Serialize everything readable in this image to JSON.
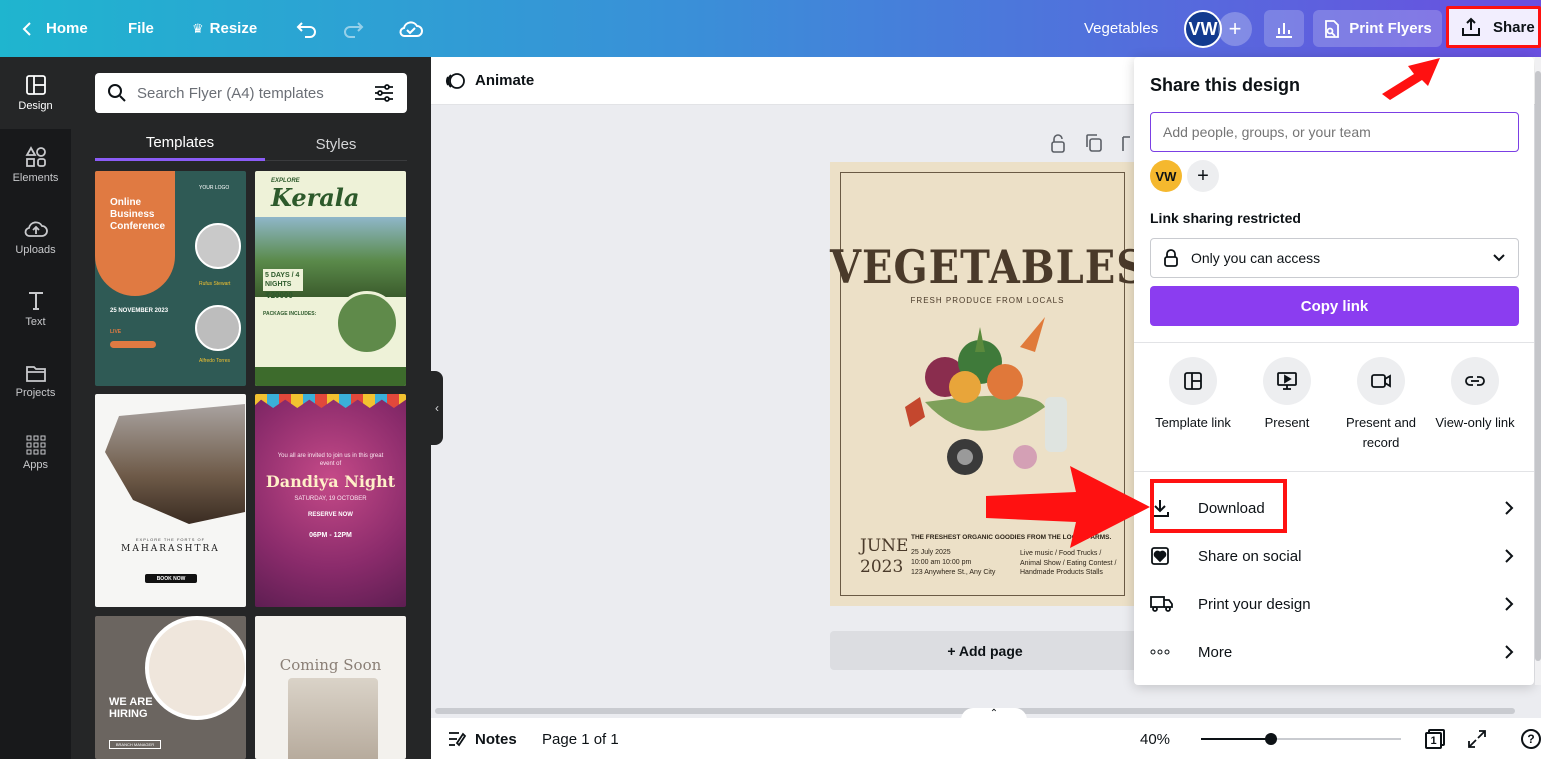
{
  "topbar": {
    "home": "Home",
    "file": "File",
    "resize": "Resize",
    "design_title": "Vegetables",
    "avatar_initials": "VW",
    "print_button": "Print Flyers",
    "share_button": "Share"
  },
  "rail": {
    "items": [
      {
        "label": "Design",
        "icon": "design-icon"
      },
      {
        "label": "Elements",
        "icon": "elements-icon"
      },
      {
        "label": "Uploads",
        "icon": "uploads-icon"
      },
      {
        "label": "Text",
        "icon": "text-icon"
      },
      {
        "label": "Projects",
        "icon": "projects-icon"
      },
      {
        "label": "Apps",
        "icon": "apps-icon"
      }
    ]
  },
  "panel": {
    "search_placeholder": "Search Flyer (A4) templates",
    "tabs": [
      "Templates",
      "Styles"
    ],
    "templates": [
      {
        "title": "Online Business Conference",
        "date": "25 NOVEMBER 2023",
        "person1": "Rufus Stewart",
        "person2": "Alfredo Torres",
        "logo": "YOUR LOGO",
        "tag": "LIVE"
      },
      {
        "title": "Kerala",
        "pre": "EXPLORE",
        "days": "5 DAYS / 4 NIGHTS",
        "price": "₹20000",
        "package": "PACKAGE INCLUDES:"
      },
      {
        "title": "MAHARASHTRA",
        "pre": "EXPLORE THE FORTS OF",
        "cta": "BOOK NOW"
      },
      {
        "title": "Dandiya Night",
        "intro": "You all are invited to join us in this great event of",
        "date": "SATURDAY, 19 OCTOBER",
        "reserve": "RESERVE NOW",
        "time": "06PM - 12PM"
      },
      {
        "title": "WE ARE HIRING",
        "cta": "BRANCH MANAGER"
      },
      {
        "title": "Coming Soon"
      }
    ]
  },
  "canvas": {
    "animate": "Animate",
    "add_page": "+ Add page",
    "flyer": {
      "title": "VEGETABLES",
      "subtitle": "FRESH PRODUCE FROM LOCALS",
      "month": "JUNE",
      "year": "2023",
      "headline": "THE FRESHEST ORGANIC GOODIES FROM THE LOCAL FARMS.",
      "date": "25 July 2025",
      "time": "10:00 am  10:00 pm",
      "address": "123 Anywhere St., Any City",
      "activities": "Live music / Food Trucks / Animal Show / Eating Contest / Handmade Products Stalls"
    }
  },
  "bottombar": {
    "notes": "Notes",
    "page": "Page 1 of 1",
    "zoom": "40%",
    "zoom_fraction": 0.35,
    "page_count_badge": "1"
  },
  "share_panel": {
    "title": "Share this design",
    "input_placeholder": "Add people, groups, or your team",
    "avatar_initials": "VW",
    "link_label": "Link sharing restricted",
    "access_value": "Only you can access",
    "copy_link": "Copy link",
    "options": [
      {
        "label": "Template link",
        "icon": "template-link-icon"
      },
      {
        "label": "Present",
        "icon": "present-icon"
      },
      {
        "label": "Present and record",
        "icon": "record-icon"
      },
      {
        "label": "View-only link",
        "icon": "link-icon"
      }
    ],
    "rows": [
      {
        "label": "Download",
        "icon": "download-icon"
      },
      {
        "label": "Share on social",
        "icon": "heart-icon"
      },
      {
        "label": "Print your design",
        "icon": "truck-icon"
      },
      {
        "label": "More",
        "icon": "more-icon"
      }
    ]
  },
  "colors": {
    "accent": "#8b3df0",
    "highlight": "#ff1111",
    "rail_bg": "#18191b",
    "panel_bg": "#252627"
  }
}
